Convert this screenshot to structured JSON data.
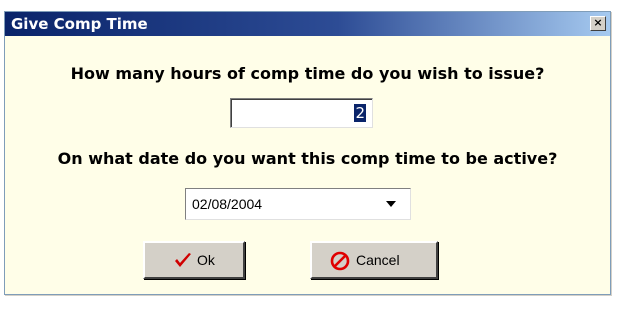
{
  "window": {
    "title": "Give Comp Time",
    "close_glyph": "×"
  },
  "hours": {
    "question": "How many hours of comp time do you wish to issue?",
    "value": "2"
  },
  "date": {
    "question": "On what date do you want this comp time to be active?",
    "value": "02/08/2004"
  },
  "buttons": {
    "ok_label": "Ok",
    "cancel_label": "Cancel"
  },
  "icons": {
    "ok": "checkmark-icon",
    "cancel": "prohibited-icon",
    "close": "close-icon",
    "dropdown": "chevron-down-icon"
  },
  "colors": {
    "dialog_bg": "#fffee8",
    "titlebar": "#0a246a",
    "ok_icon": "#d00000",
    "cancel_icon": "#e00000"
  }
}
